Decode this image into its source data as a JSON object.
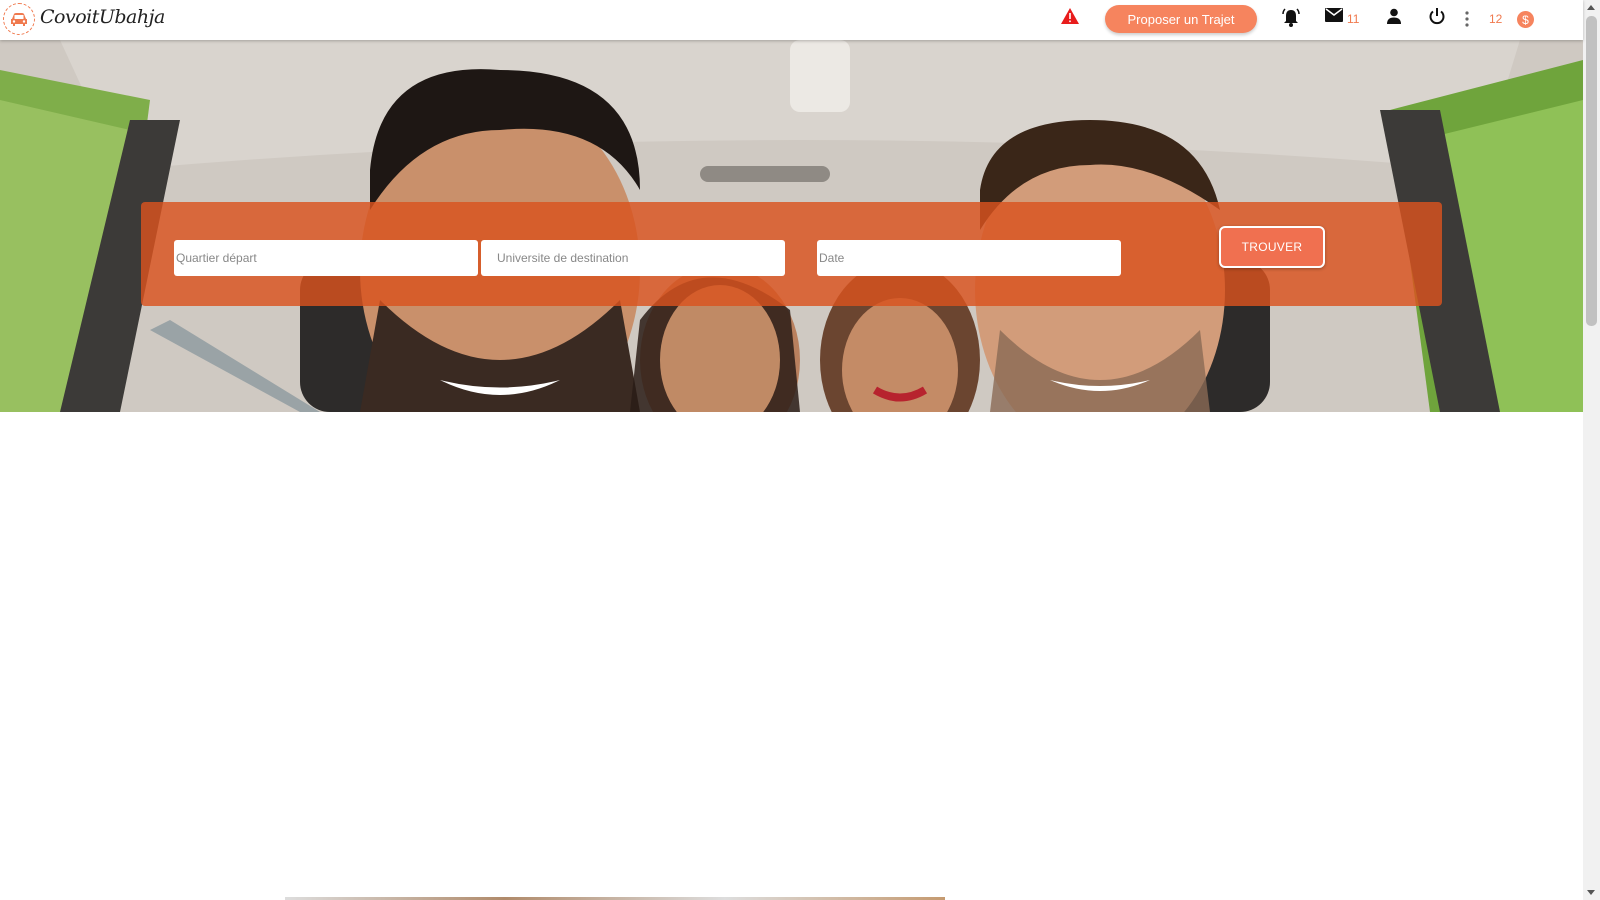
{
  "brand": {
    "name": "CovoitUbahja",
    "logo_icon": "car-icon",
    "accent": "#f07a4f"
  },
  "header": {
    "alert_icon": "warning-icon",
    "propose_label": "Proposer un Trajet",
    "notifications_icon": "bell-icon",
    "messages_icon": "mail-icon",
    "messages_count": "11",
    "profile_icon": "person-icon",
    "logout_icon": "power-icon",
    "more_icon": "more-vert-icon",
    "coins_count": "12",
    "coins_icon": "dollar-icon"
  },
  "search": {
    "departure_placeholder": "Quartier départ",
    "destination_placeholder": "Universite de destination",
    "date_placeholder": "Date",
    "find_label": "TROUVER"
  },
  "colors": {
    "panel": "#d9531e",
    "button": "#f07050",
    "propose": "#f6845e"
  }
}
